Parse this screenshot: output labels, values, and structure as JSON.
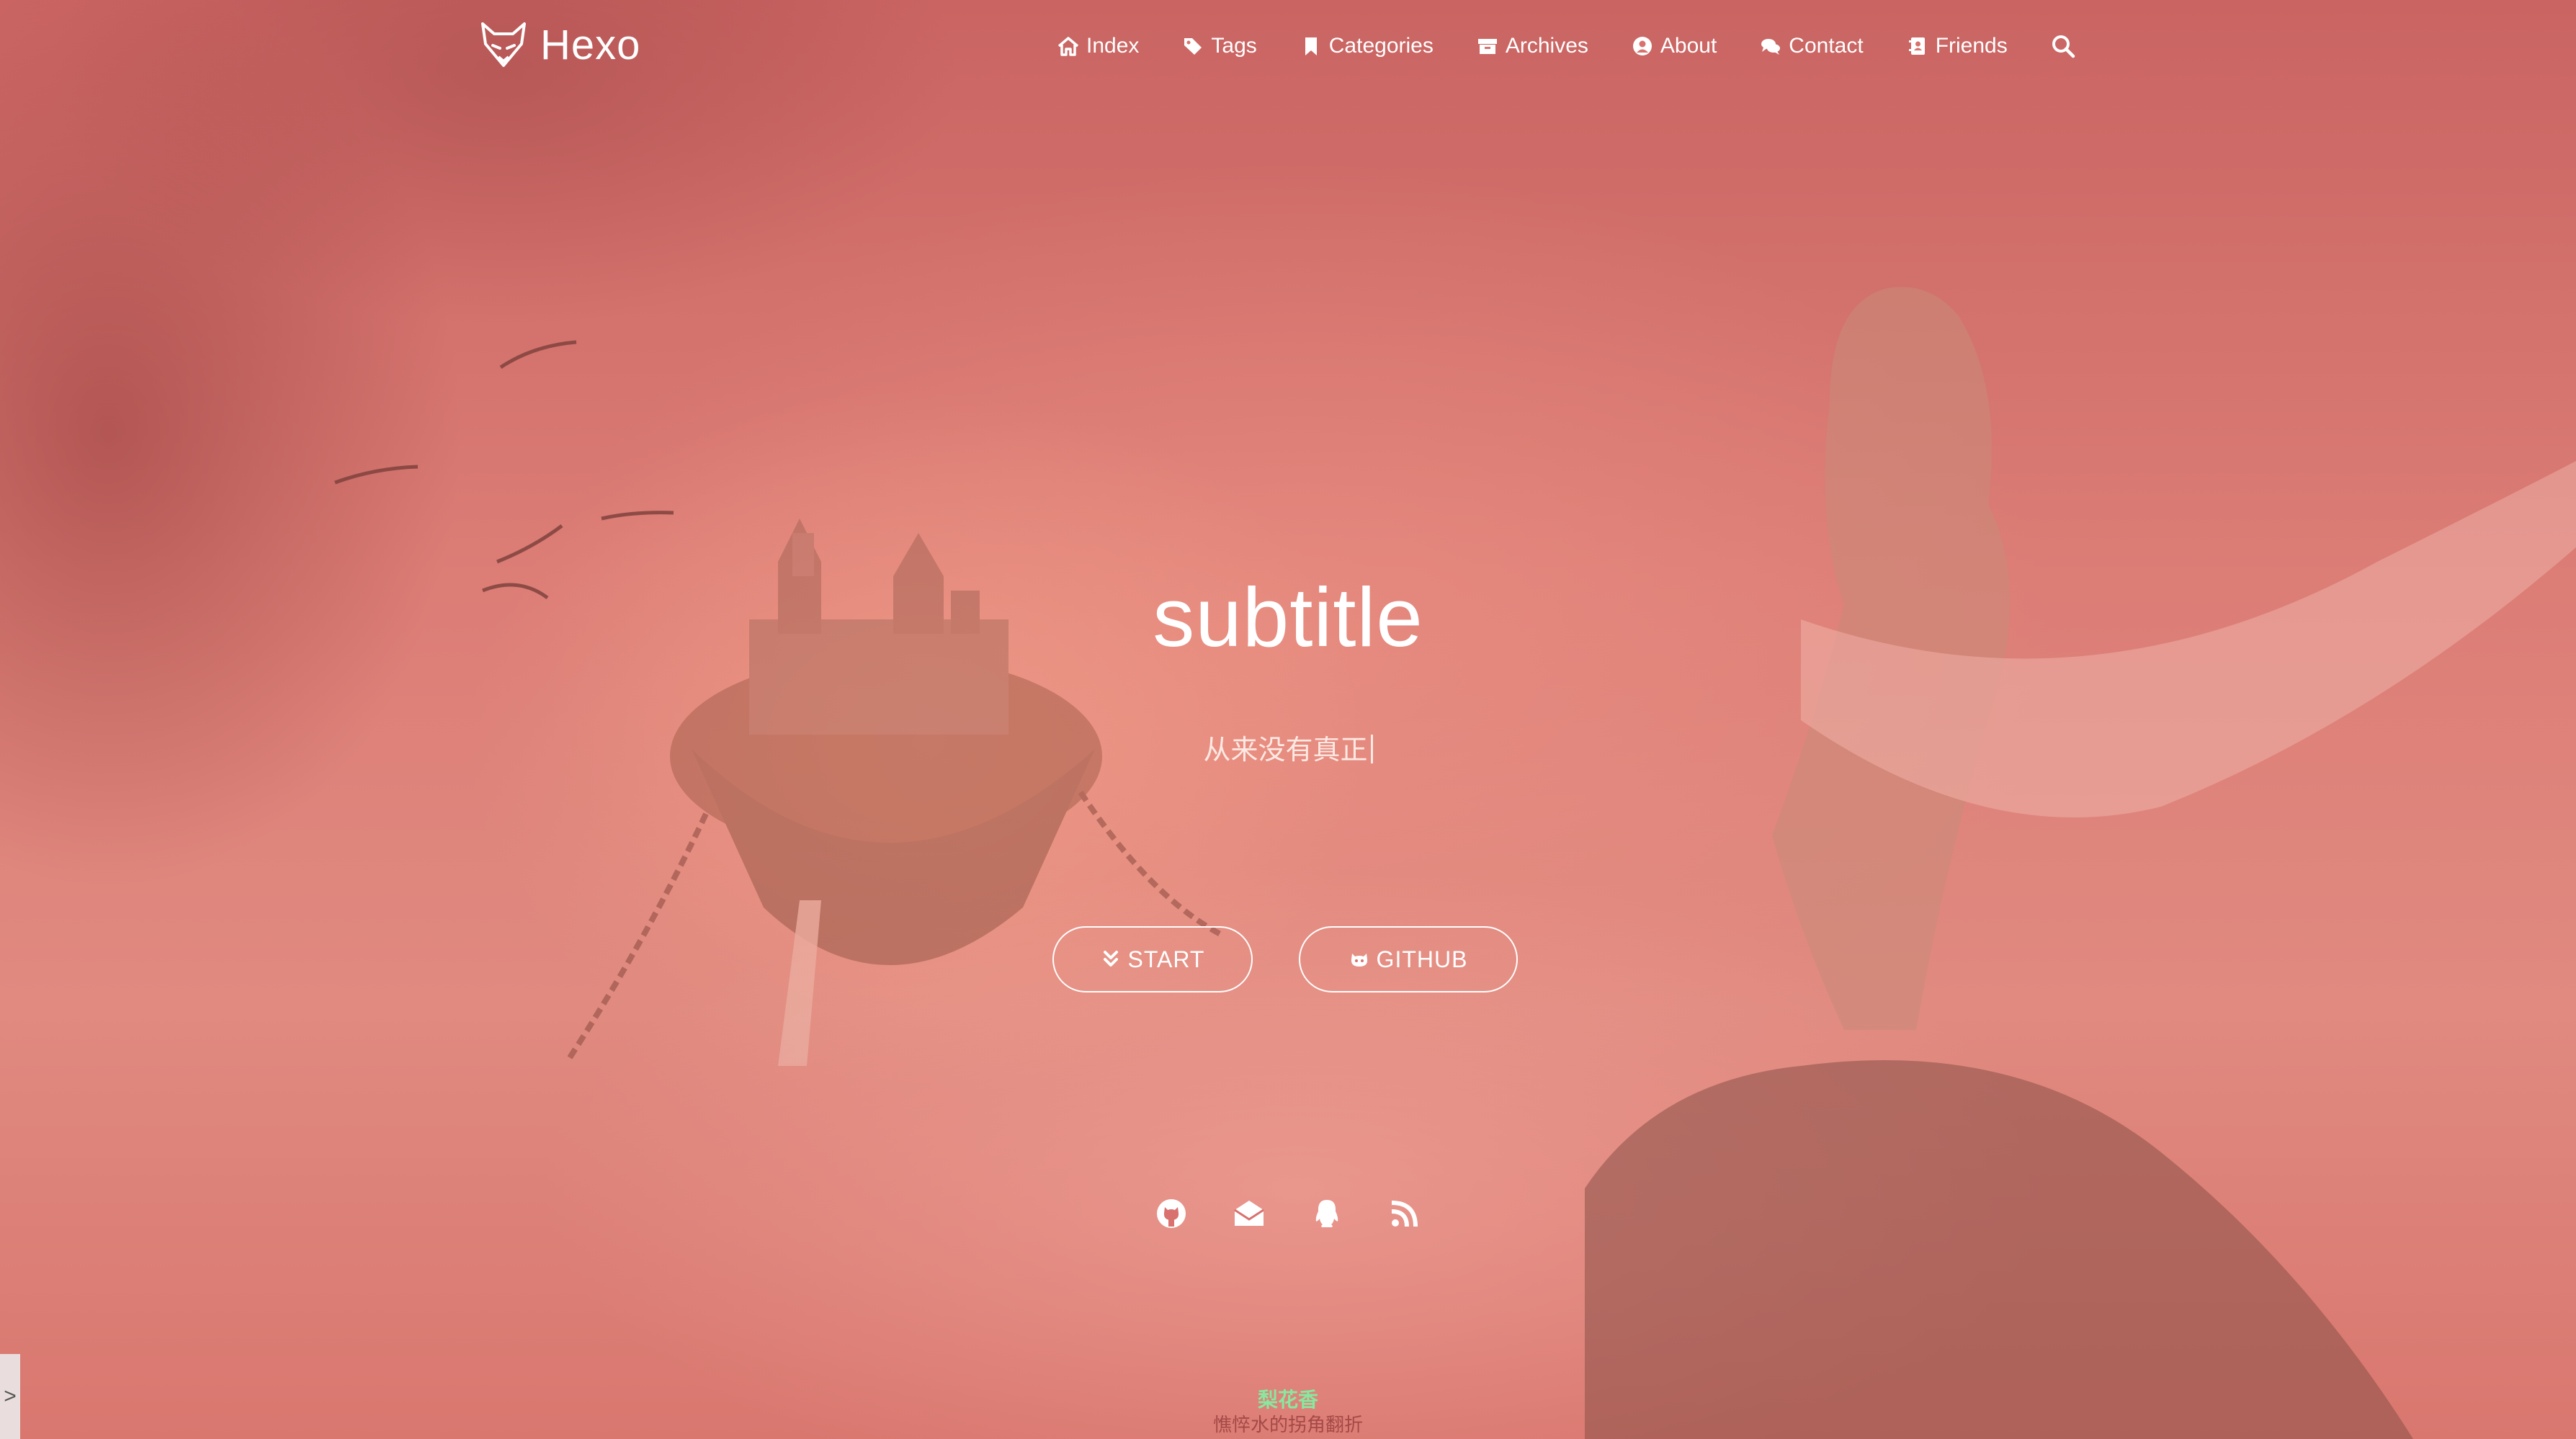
{
  "brand": {
    "name": "Hexo",
    "logo_icon": "fox-logo-icon"
  },
  "nav": {
    "items": [
      {
        "label": "Index",
        "icon": "home-icon"
      },
      {
        "label": "Tags",
        "icon": "tags-icon"
      },
      {
        "label": "Categories",
        "icon": "bookmark-icon"
      },
      {
        "label": "Archives",
        "icon": "archive-icon"
      },
      {
        "label": "About",
        "icon": "user-circle-icon"
      },
      {
        "label": "Contact",
        "icon": "comments-icon"
      },
      {
        "label": "Friends",
        "icon": "address-book-icon"
      }
    ],
    "search_icon": "search-icon"
  },
  "hero": {
    "title": "subtitle",
    "typed_text": "从来没有真正"
  },
  "buttons": {
    "start_label": "START",
    "github_label": "GITHUB"
  },
  "social": [
    "github-icon",
    "envelope-icon",
    "qq-icon",
    "rss-icon"
  ],
  "footer": {
    "line1": "梨花香",
    "line2": "憔悴水的拐角翻折"
  },
  "side_tab": {
    "label": ">"
  },
  "colors": {
    "overlay": "#d9716e",
    "text": "#ffffff",
    "footer_green": "#88e7a0"
  }
}
